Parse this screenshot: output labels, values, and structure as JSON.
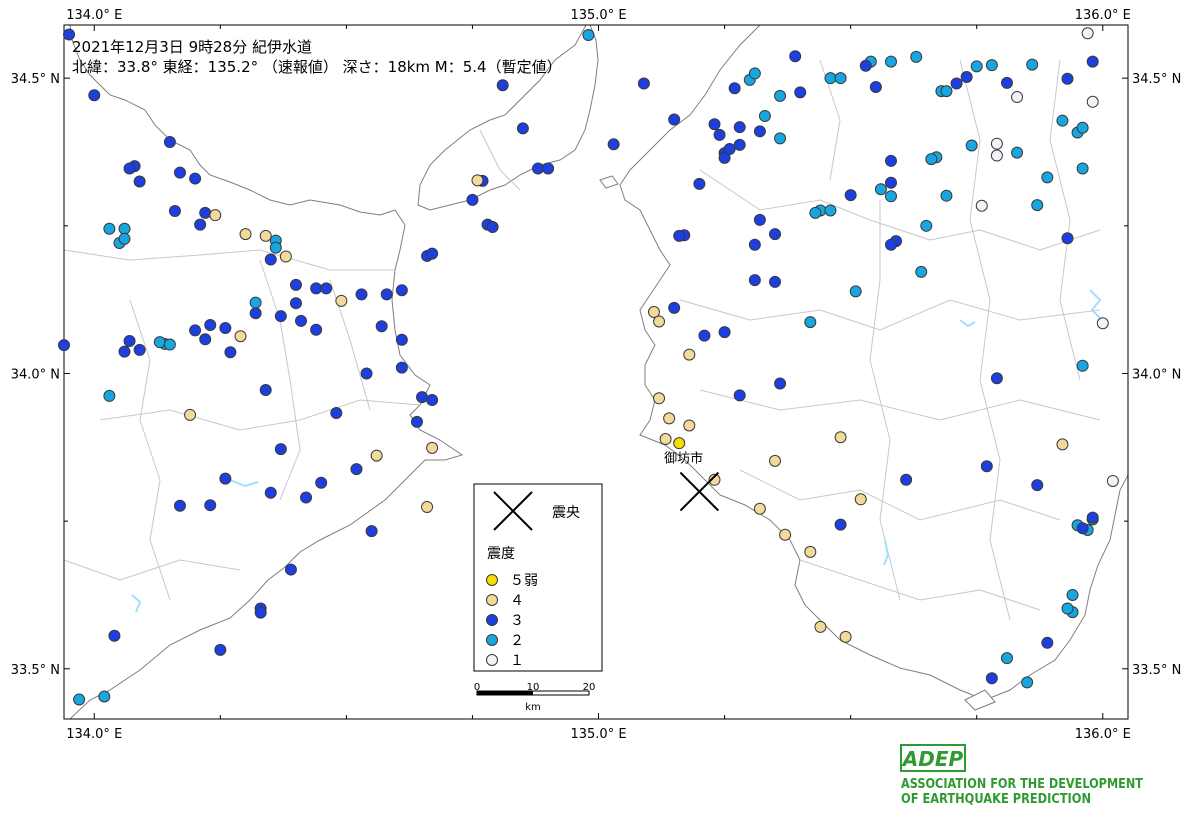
{
  "header": {
    "line1": "2021年12月3日 9時28分 紀伊水道",
    "line2": "北緯：33.8° 東経：135.2° （速報値） 深さ：18km M：5.4（暫定値）"
  },
  "axes": {
    "top": [
      {
        "text": "134.0° E",
        "lon": 134.0
      },
      {
        "text": "135.0° E",
        "lon": 135.0
      },
      {
        "text": "136.0° E",
        "lon": 136.0
      }
    ],
    "bottom": [
      {
        "text": "134.0° E",
        "lon": 134.0
      },
      {
        "text": "135.0° E",
        "lon": 135.0
      },
      {
        "text": "136.0° E",
        "lon": 136.0
      }
    ],
    "left": [
      {
        "text": "34.5° N",
        "lat": 34.5
      },
      {
        "text": "34.0° N",
        "lat": 34.0
      },
      {
        "text": "33.5° N",
        "lat": 33.5
      }
    ],
    "right": [
      {
        "text": "34.5° N",
        "lat": 34.5
      },
      {
        "text": "34.0° N",
        "lat": 34.0
      },
      {
        "text": "33.5° N",
        "lat": 33.5
      }
    ]
  },
  "city": {
    "name": "御坊市",
    "lat": 33.89,
    "lon": 135.15
  },
  "epicenter": {
    "lat": 33.8,
    "lon": 135.2
  },
  "legend": {
    "epicenter_label": "震央",
    "title": "震度",
    "items": [
      {
        "label": "５弱",
        "color": "#f5dd00"
      },
      {
        "label": "４",
        "color": "#f3d99a"
      },
      {
        "label": "３",
        "color": "#1e3fe0"
      },
      {
        "label": "２",
        "color": "#18a6e0"
      },
      {
        "label": "１",
        "color": "#f2f2f8"
      }
    ],
    "scale": {
      "ticks": [
        "0",
        "10",
        "20"
      ],
      "unit": "km"
    }
  },
  "logo": {
    "acronym": "ADEP",
    "line1": "ASSOCIATION FOR THE DEVELOPMENT",
    "line2": "OF EARTHQUAKE PREDICTION"
  },
  "colors": {
    "5-": "#f5dd00",
    "4": "#f3d99a",
    "3": "#1e3fe0",
    "2": "#18a6e0",
    "1": "#f2f2f8",
    "land": "#ffffff",
    "sea": "#ffffff",
    "coast": "#808080",
    "boundary": "#c8c8c8",
    "logo": "#2f9a2f"
  },
  "map": {
    "lon_min": 133.94,
    "lon_max": 136.05,
    "lat_min": 33.415,
    "lat_max": 34.59
  },
  "stations": [
    {
      "lon": 135.16,
      "lat": 33.882,
      "i": "5-"
    },
    {
      "lon": 134.24,
      "lat": 34.268,
      "i": "4"
    },
    {
      "lon": 134.3,
      "lat": 34.236,
      "i": "4"
    },
    {
      "lon": 134.34,
      "lat": 34.233,
      "i": "4"
    },
    {
      "lon": 134.38,
      "lat": 34.198,
      "i": "4"
    },
    {
      "lon": 134.49,
      "lat": 34.123,
      "i": "4"
    },
    {
      "lon": 134.29,
      "lat": 34.063,
      "i": "4"
    },
    {
      "lon": 134.19,
      "lat": 33.93,
      "i": "4"
    },
    {
      "lon": 134.56,
      "lat": 33.861,
      "i": "4"
    },
    {
      "lon": 134.67,
      "lat": 33.874,
      "i": "4"
    },
    {
      "lon": 134.66,
      "lat": 33.774,
      "i": "4"
    },
    {
      "lon": 134.76,
      "lat": 34.327,
      "i": "4"
    },
    {
      "lon": 135.11,
      "lat": 34.104,
      "i": "4"
    },
    {
      "lon": 135.12,
      "lat": 34.088,
      "i": "4"
    },
    {
      "lon": 135.18,
      "lat": 34.032,
      "i": "4"
    },
    {
      "lon": 135.12,
      "lat": 33.958,
      "i": "4"
    },
    {
      "lon": 135.14,
      "lat": 33.924,
      "i": "4"
    },
    {
      "lon": 135.18,
      "lat": 33.912,
      "i": "4"
    },
    {
      "lon": 135.133,
      "lat": 33.889,
      "i": "4"
    },
    {
      "lon": 135.23,
      "lat": 33.82,
      "i": "4"
    },
    {
      "lon": 135.35,
      "lat": 33.852,
      "i": "4"
    },
    {
      "lon": 135.32,
      "lat": 33.771,
      "i": "4"
    },
    {
      "lon": 135.37,
      "lat": 33.727,
      "i": "4"
    },
    {
      "lon": 135.42,
      "lat": 33.698,
      "i": "4"
    },
    {
      "lon": 135.48,
      "lat": 33.892,
      "i": "4"
    },
    {
      "lon": 135.52,
      "lat": 33.787,
      "i": "4"
    },
    {
      "lon": 135.44,
      "lat": 33.571,
      "i": "4"
    },
    {
      "lon": 135.49,
      "lat": 33.554,
      "i": "4"
    },
    {
      "lon": 135.92,
      "lat": 33.88,
      "i": "4"
    },
    {
      "lon": 133.95,
      "lat": 34.574,
      "i": "3"
    },
    {
      "lon": 134.0,
      "lat": 34.471,
      "i": "3"
    },
    {
      "lon": 134.15,
      "lat": 34.392,
      "i": "3"
    },
    {
      "lon": 134.08,
      "lat": 34.351,
      "i": "3"
    },
    {
      "lon": 134.07,
      "lat": 34.347,
      "i": "3"
    },
    {
      "lon": 134.09,
      "lat": 34.325,
      "i": "3"
    },
    {
      "lon": 134.17,
      "lat": 34.34,
      "i": "3"
    },
    {
      "lon": 134.2,
      "lat": 34.33,
      "i": "3"
    },
    {
      "lon": 134.16,
      "lat": 34.275,
      "i": "3"
    },
    {
      "lon": 134.22,
      "lat": 34.272,
      "i": "3"
    },
    {
      "lon": 134.21,
      "lat": 34.252,
      "i": "3"
    },
    {
      "lon": 134.44,
      "lat": 34.144,
      "i": "3"
    },
    {
      "lon": 134.53,
      "lat": 34.134,
      "i": "3"
    },
    {
      "lon": 134.58,
      "lat": 34.134,
      "i": "3"
    },
    {
      "lon": 134.61,
      "lat": 34.141,
      "i": "3"
    },
    {
      "lon": 134.4,
      "lat": 34.119,
      "i": "3"
    },
    {
      "lon": 134.32,
      "lat": 34.102,
      "i": "3"
    },
    {
      "lon": 134.37,
      "lat": 34.097,
      "i": "3"
    },
    {
      "lon": 134.41,
      "lat": 34.089,
      "i": "3"
    },
    {
      "lon": 134.44,
      "lat": 34.074,
      "i": "3"
    },
    {
      "lon": 134.57,
      "lat": 34.08,
      "i": "3"
    },
    {
      "lon": 134.61,
      "lat": 34.057,
      "i": "3"
    },
    {
      "lon": 134.2,
      "lat": 34.073,
      "i": "3"
    },
    {
      "lon": 134.23,
      "lat": 34.082,
      "i": "3"
    },
    {
      "lon": 134.26,
      "lat": 34.077,
      "i": "3"
    },
    {
      "lon": 134.22,
      "lat": 34.058,
      "i": "3"
    },
    {
      "lon": 134.27,
      "lat": 34.036,
      "i": "3"
    },
    {
      "lon": 134.07,
      "lat": 34.055,
      "i": "3"
    },
    {
      "lon": 134.06,
      "lat": 34.037,
      "i": "3"
    },
    {
      "lon": 134.09,
      "lat": 34.04,
      "i": "3"
    },
    {
      "lon": 133.94,
      "lat": 34.048,
      "i": "3"
    },
    {
      "lon": 134.54,
      "lat": 34.0,
      "i": "3"
    },
    {
      "lon": 134.61,
      "lat": 34.01,
      "i": "3"
    },
    {
      "lon": 134.65,
      "lat": 33.96,
      "i": "3"
    },
    {
      "lon": 134.67,
      "lat": 33.955,
      "i": "3"
    },
    {
      "lon": 134.64,
      "lat": 33.918,
      "i": "3"
    },
    {
      "lon": 134.34,
      "lat": 33.972,
      "i": "3"
    },
    {
      "lon": 134.48,
      "lat": 33.933,
      "i": "3"
    },
    {
      "lon": 134.37,
      "lat": 33.872,
      "i": "3"
    },
    {
      "lon": 134.52,
      "lat": 33.838,
      "i": "3"
    },
    {
      "lon": 134.26,
      "lat": 33.822,
      "i": "3"
    },
    {
      "lon": 134.35,
      "lat": 33.798,
      "i": "3"
    },
    {
      "lon": 134.42,
      "lat": 33.79,
      "i": "3"
    },
    {
      "lon": 134.45,
      "lat": 33.815,
      "i": "3"
    },
    {
      "lon": 134.23,
      "lat": 33.777,
      "i": "3"
    },
    {
      "lon": 134.55,
      "lat": 33.733,
      "i": "3"
    },
    {
      "lon": 134.39,
      "lat": 33.668,
      "i": "3"
    },
    {
      "lon": 134.33,
      "lat": 33.602,
      "i": "3"
    },
    {
      "lon": 134.33,
      "lat": 33.595,
      "i": "3"
    },
    {
      "lon": 134.04,
      "lat": 33.556,
      "i": "3"
    },
    {
      "lon": 134.25,
      "lat": 33.532,
      "i": "3"
    },
    {
      "lon": 134.17,
      "lat": 33.776,
      "i": "3"
    },
    {
      "lon": 134.35,
      "lat": 34.193,
      "i": "3"
    },
    {
      "lon": 134.4,
      "lat": 34.15,
      "i": "3"
    },
    {
      "lon": 134.46,
      "lat": 34.144,
      "i": "3"
    },
    {
      "lon": 134.77,
      "lat": 34.326,
      "i": "3"
    },
    {
      "lon": 134.75,
      "lat": 34.294,
      "i": "3"
    },
    {
      "lon": 134.78,
      "lat": 34.252,
      "i": "3"
    },
    {
      "lon": 134.79,
      "lat": 34.248,
      "i": "3"
    },
    {
      "lon": 134.85,
      "lat": 34.415,
      "i": "3"
    },
    {
      "lon": 134.88,
      "lat": 34.347,
      "i": "3"
    },
    {
      "lon": 134.9,
      "lat": 34.347,
      "i": "3"
    },
    {
      "lon": 134.81,
      "lat": 34.488,
      "i": "3"
    },
    {
      "lon": 134.66,
      "lat": 34.199,
      "i": "3"
    },
    {
      "lon": 134.67,
      "lat": 34.203,
      "i": "3"
    },
    {
      "lon": 135.27,
      "lat": 34.483,
      "i": "3"
    },
    {
      "lon": 135.2,
      "lat": 34.321,
      "i": "3"
    },
    {
      "lon": 135.25,
      "lat": 34.373,
      "i": "3"
    },
    {
      "lon": 135.25,
      "lat": 34.365,
      "i": "3"
    },
    {
      "lon": 135.26,
      "lat": 34.38,
      "i": "3"
    },
    {
      "lon": 135.28,
      "lat": 34.387,
      "i": "3"
    },
    {
      "lon": 135.17,
      "lat": 34.234,
      "i": "3"
    },
    {
      "lon": 135.16,
      "lat": 34.233,
      "i": "3"
    },
    {
      "lon": 135.32,
      "lat": 34.26,
      "i": "3"
    },
    {
      "lon": 135.31,
      "lat": 34.218,
      "i": "3"
    },
    {
      "lon": 135.35,
      "lat": 34.236,
      "i": "3"
    },
    {
      "lon": 135.31,
      "lat": 34.158,
      "i": "3"
    },
    {
      "lon": 135.35,
      "lat": 34.155,
      "i": "3"
    },
    {
      "lon": 135.15,
      "lat": 34.111,
      "i": "3"
    },
    {
      "lon": 135.21,
      "lat": 34.064,
      "i": "3"
    },
    {
      "lon": 135.25,
      "lat": 34.07,
      "i": "3"
    },
    {
      "lon": 135.28,
      "lat": 33.963,
      "i": "3"
    },
    {
      "lon": 135.36,
      "lat": 33.983,
      "i": "3"
    },
    {
      "lon": 135.5,
      "lat": 34.302,
      "i": "3"
    },
    {
      "lon": 135.58,
      "lat": 34.323,
      "i": "3"
    },
    {
      "lon": 135.59,
      "lat": 34.224,
      "i": "3"
    },
    {
      "lon": 135.58,
      "lat": 34.218,
      "i": "3"
    },
    {
      "lon": 135.58,
      "lat": 34.36,
      "i": "3"
    },
    {
      "lon": 135.48,
      "lat": 33.744,
      "i": "3"
    },
    {
      "lon": 135.61,
      "lat": 33.82,
      "i": "3"
    },
    {
      "lon": 135.79,
      "lat": 33.992,
      "i": "3"
    },
    {
      "lon": 135.77,
      "lat": 33.843,
      "i": "3"
    },
    {
      "lon": 135.87,
      "lat": 33.811,
      "i": "3"
    },
    {
      "lon": 135.98,
      "lat": 33.756,
      "i": "3"
    },
    {
      "lon": 135.96,
      "lat": 33.738,
      "i": "3"
    },
    {
      "lon": 135.93,
      "lat": 34.229,
      "i": "3"
    },
    {
      "lon": 135.89,
      "lat": 33.544,
      "i": "3"
    },
    {
      "lon": 135.78,
      "lat": 33.484,
      "i": "3"
    },
    {
      "lon": 135.4,
      "lat": 34.476,
      "i": "3"
    },
    {
      "lon": 135.39,
      "lat": 34.537,
      "i": "3"
    },
    {
      "lon": 135.53,
      "lat": 34.521,
      "i": "3"
    },
    {
      "lon": 135.55,
      "lat": 34.485,
      "i": "3"
    },
    {
      "lon": 135.71,
      "lat": 34.491,
      "i": "3"
    },
    {
      "lon": 135.73,
      "lat": 34.502,
      "i": "3"
    },
    {
      "lon": 135.81,
      "lat": 34.492,
      "i": "3"
    },
    {
      "lon": 135.93,
      "lat": 34.499,
      "i": "3"
    },
    {
      "lon": 135.98,
      "lat": 34.528,
      "i": "3"
    },
    {
      "lon": 135.23,
      "lat": 34.422,
      "i": "3"
    },
    {
      "lon": 135.24,
      "lat": 34.404,
      "i": "3"
    },
    {
      "lon": 135.28,
      "lat": 34.417,
      "i": "3"
    },
    {
      "lon": 135.32,
      "lat": 34.41,
      "i": "3"
    },
    {
      "lon": 135.15,
      "lat": 34.43,
      "i": "3"
    },
    {
      "lon": 135.09,
      "lat": 34.491,
      "i": "3"
    },
    {
      "lon": 135.03,
      "lat": 34.388,
      "i": "3"
    },
    {
      "lon": 134.03,
      "lat": 34.245,
      "i": "2"
    },
    {
      "lon": 134.06,
      "lat": 34.245,
      "i": "2"
    },
    {
      "lon": 134.05,
      "lat": 34.221,
      "i": "2"
    },
    {
      "lon": 134.06,
      "lat": 34.228,
      "i": "2"
    },
    {
      "lon": 134.14,
      "lat": 34.05,
      "i": "2"
    },
    {
      "lon": 134.13,
      "lat": 34.053,
      "i": "2"
    },
    {
      "lon": 134.15,
      "lat": 34.049,
      "i": "2"
    },
    {
      "lon": 134.03,
      "lat": 33.962,
      "i": "2"
    },
    {
      "lon": 134.36,
      "lat": 34.225,
      "i": "2"
    },
    {
      "lon": 134.36,
      "lat": 34.213,
      "i": "2"
    },
    {
      "lon": 134.32,
      "lat": 34.12,
      "i": "2"
    },
    {
      "lon": 133.97,
      "lat": 33.448,
      "i": "2"
    },
    {
      "lon": 134.02,
      "lat": 33.453,
      "i": "2"
    },
    {
      "lon": 135.44,
      "lat": 34.276,
      "i": "2"
    },
    {
      "lon": 135.43,
      "lat": 34.272,
      "i": "2"
    },
    {
      "lon": 135.46,
      "lat": 34.276,
      "i": "2"
    },
    {
      "lon": 135.51,
      "lat": 34.139,
      "i": "2"
    },
    {
      "lon": 135.42,
      "lat": 34.087,
      "i": "2"
    },
    {
      "lon": 135.58,
      "lat": 34.3,
      "i": "2"
    },
    {
      "lon": 135.56,
      "lat": 34.312,
      "i": "2"
    },
    {
      "lon": 135.64,
      "lat": 34.172,
      "i": "2"
    },
    {
      "lon": 135.67,
      "lat": 34.366,
      "i": "2"
    },
    {
      "lon": 135.87,
      "lat": 34.285,
      "i": "2"
    },
    {
      "lon": 135.89,
      "lat": 34.332,
      "i": "2"
    },
    {
      "lon": 135.95,
      "lat": 34.408,
      "i": "2"
    },
    {
      "lon": 135.96,
      "lat": 34.416,
      "i": "2"
    },
    {
      "lon": 135.96,
      "lat": 34.347,
      "i": "2"
    },
    {
      "lon": 135.96,
      "lat": 34.013,
      "i": "2"
    },
    {
      "lon": 135.94,
      "lat": 33.625,
      "i": "2"
    },
    {
      "lon": 135.94,
      "lat": 33.596,
      "i": "2"
    },
    {
      "lon": 135.93,
      "lat": 33.602,
      "i": "2"
    },
    {
      "lon": 135.97,
      "lat": 33.735,
      "i": "2"
    },
    {
      "lon": 135.85,
      "lat": 33.477,
      "i": "2"
    },
    {
      "lon": 135.81,
      "lat": 33.518,
      "i": "2"
    },
    {
      "lon": 135.95,
      "lat": 33.743,
      "i": "2"
    },
    {
      "lon": 135.92,
      "lat": 34.428,
      "i": "2"
    },
    {
      "lon": 135.3,
      "lat": 34.497,
      "i": "2"
    },
    {
      "lon": 135.31,
      "lat": 34.508,
      "i": "2"
    },
    {
      "lon": 135.36,
      "lat": 34.47,
      "i": "2"
    },
    {
      "lon": 135.33,
      "lat": 34.436,
      "i": "2"
    },
    {
      "lon": 135.46,
      "lat": 34.5,
      "i": "2"
    },
    {
      "lon": 135.48,
      "lat": 34.5,
      "i": "2"
    },
    {
      "lon": 135.54,
      "lat": 34.528,
      "i": "2"
    },
    {
      "lon": 135.58,
      "lat": 34.528,
      "i": "2"
    },
    {
      "lon": 135.68,
      "lat": 34.478,
      "i": "2"
    },
    {
      "lon": 135.69,
      "lat": 34.478,
      "i": "2"
    },
    {
      "lon": 135.63,
      "lat": 34.536,
      "i": "2"
    },
    {
      "lon": 135.86,
      "lat": 34.523,
      "i": "2"
    },
    {
      "lon": 135.75,
      "lat": 34.52,
      "i": "2"
    },
    {
      "lon": 135.78,
      "lat": 34.522,
      "i": "2"
    },
    {
      "lon": 135.83,
      "lat": 34.374,
      "i": "2"
    },
    {
      "lon": 135.36,
      "lat": 34.398,
      "i": "2"
    },
    {
      "lon": 134.98,
      "lat": 34.573,
      "i": "2"
    },
    {
      "lon": 135.65,
      "lat": 34.25,
      "i": "2"
    },
    {
      "lon": 135.69,
      "lat": 34.301,
      "i": "2"
    },
    {
      "lon": 135.66,
      "lat": 34.363,
      "i": "2"
    },
    {
      "lon": 135.74,
      "lat": 34.386,
      "i": "2"
    },
    {
      "lon": 135.98,
      "lat": 33.753,
      "i": "2"
    },
    {
      "lon": 135.83,
      "lat": 34.468,
      "i": "1"
    },
    {
      "lon": 135.97,
      "lat": 34.576,
      "i": "1"
    },
    {
      "lon": 135.76,
      "lat": 34.284,
      "i": "1"
    },
    {
      "lon": 135.98,
      "lat": 34.46,
      "i": "1"
    },
    {
      "lon": 136.0,
      "lat": 34.085,
      "i": "1"
    },
    {
      "lon": 135.79,
      "lat": 34.389,
      "i": "1"
    },
    {
      "lon": 135.79,
      "lat": 34.369,
      "i": "1"
    },
    {
      "lon": 136.02,
      "lat": 33.818,
      "i": "1"
    }
  ]
}
